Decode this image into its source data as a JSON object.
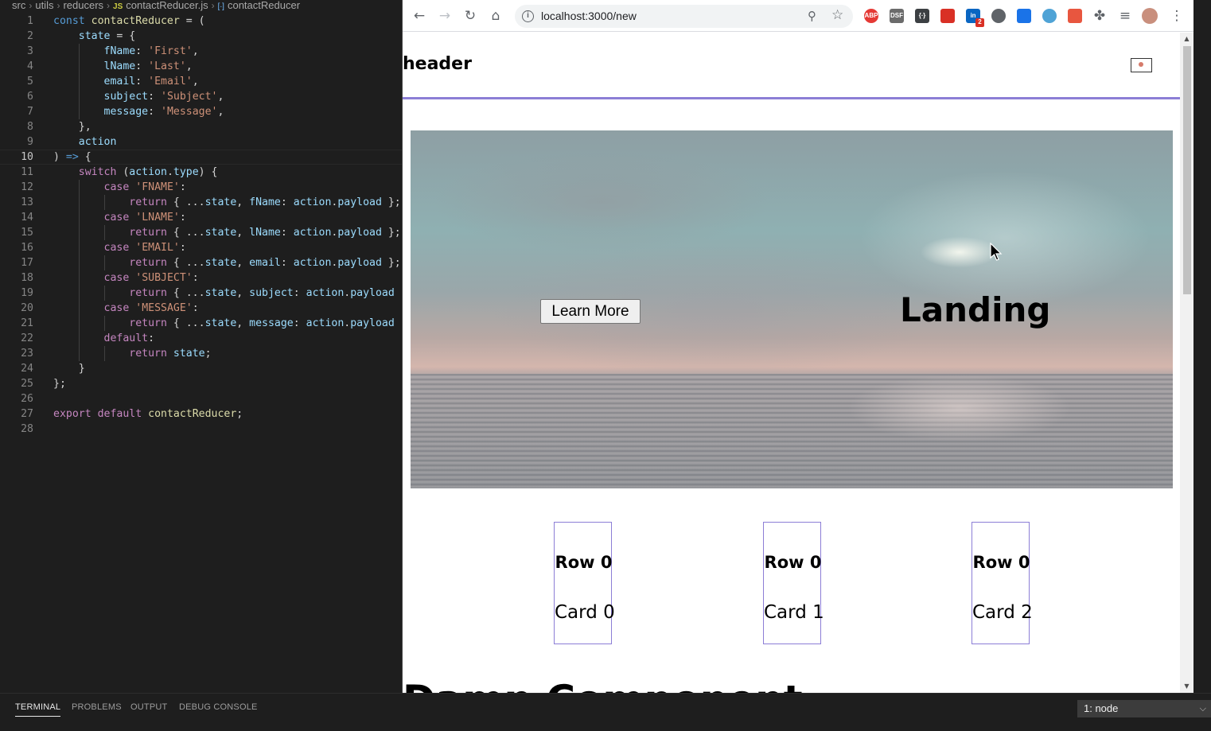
{
  "editor": {
    "breadcrumb": {
      "segments": [
        "src",
        "utils",
        "reducers"
      ],
      "file_badge": "JS",
      "file": "contactReducer.js",
      "symbol_badge": "[∙]",
      "symbol": "contactReducer"
    },
    "current_line": 10,
    "lines": [
      {
        "n": "1"
      },
      {
        "n": "2"
      },
      {
        "n": "3"
      },
      {
        "n": "4"
      },
      {
        "n": "5"
      },
      {
        "n": "6"
      },
      {
        "n": "7"
      },
      {
        "n": "8"
      },
      {
        "n": "9"
      },
      {
        "n": "10"
      },
      {
        "n": "11"
      },
      {
        "n": "12"
      },
      {
        "n": "13"
      },
      {
        "n": "14"
      },
      {
        "n": "15"
      },
      {
        "n": "16"
      },
      {
        "n": "17"
      },
      {
        "n": "18"
      },
      {
        "n": "19"
      },
      {
        "n": "20"
      },
      {
        "n": "21"
      },
      {
        "n": "22"
      },
      {
        "n": "23"
      },
      {
        "n": "24"
      },
      {
        "n": "25"
      },
      {
        "n": "26"
      },
      {
        "n": "27"
      },
      {
        "n": "28"
      }
    ],
    "tokens": {
      "t1a": "const",
      "t1b": "contactReducer",
      "t1c": " = (",
      "t2a": "state",
      "t2b": " = {",
      "t3a": "fName",
      "t3b": ": ",
      "t3c": "'First'",
      "t3d": ",",
      "t4a": "lName",
      "t4b": ": ",
      "t4c": "'Last'",
      "t4d": ",",
      "t5a": "email",
      "t5b": ": ",
      "t5c": "'Email'",
      "t5d": ",",
      "t6a": "subject",
      "t6b": ": ",
      "t6c": "'Subject'",
      "t6d": ",",
      "t7a": "message",
      "t7b": ": ",
      "t7c": "'Message'",
      "t7d": ",",
      "t8a": "},",
      "t9a": "action",
      "t10a": ") ",
      "t10b": "=>",
      "t10c": " {",
      "t11a": "switch",
      "t11b": " (",
      "t11c": "action",
      "t11d": ".",
      "t11e": "type",
      "t11f": ") {",
      "t12a": "case",
      "t12b": " ",
      "t12c": "'FNAME'",
      "t12d": ":",
      "t13a": "return",
      "t13b": " { ...",
      "t13c": "state",
      "t13d": ", ",
      "t13e": "fName",
      "t13f": ": ",
      "t13g": "action",
      "t13h": ".",
      "t13i": "payload",
      "t13j": " };",
      "t14a": "case",
      "t14b": " ",
      "t14c": "'LNAME'",
      "t14d": ":",
      "t15a": "return",
      "t15b": " { ...",
      "t15c": "state",
      "t15d": ", ",
      "t15e": "lName",
      "t15f": ": ",
      "t15g": "action",
      "t15h": ".",
      "t15i": "payload",
      "t15j": " };",
      "t16a": "case",
      "t16b": " ",
      "t16c": "'EMAIL'",
      "t16d": ":",
      "t17a": "return",
      "t17b": " { ...",
      "t17c": "state",
      "t17d": ", ",
      "t17e": "email",
      "t17f": ": ",
      "t17g": "action",
      "t17h": ".",
      "t17i": "payload",
      "t17j": " };",
      "t18a": "case",
      "t18b": " ",
      "t18c": "'SUBJECT'",
      "t18d": ":",
      "t19a": "return",
      "t19b": " { ...",
      "t19c": "state",
      "t19d": ", ",
      "t19e": "subject",
      "t19f": ": ",
      "t19g": "action",
      "t19h": ".",
      "t19i": "payload",
      "t19j": " };",
      "t20a": "case",
      "t20b": " ",
      "t20c": "'MESSAGE'",
      "t20d": ":",
      "t21a": "return",
      "t21b": " { ...",
      "t21c": "state",
      "t21d": ", ",
      "t21e": "message",
      "t21f": ": ",
      "t21g": "action",
      "t21h": ".",
      "t21i": "payload",
      "t21j": " };",
      "t22a": "default",
      "t22b": ":",
      "t23a": "return",
      "t23b": " ",
      "t23c": "state",
      "t23d": ";",
      "t24a": "}",
      "t25a": "};",
      "t27a": "export",
      "t27b": " ",
      "t27c": "default",
      "t27d": " ",
      "t27e": "contactReducer",
      "t27f": ";"
    }
  },
  "panel": {
    "tabs": [
      "TERMINAL",
      "PROBLEMS",
      "OUTPUT",
      "DEBUG CONSOLE"
    ],
    "active_tab": "TERMINAL",
    "terminal_select": "1: node"
  },
  "browser": {
    "url": "localhost:3000/new",
    "extensions": [
      {
        "name": "adblock-plus-icon",
        "label": "ABP",
        "color": "#e53935"
      },
      {
        "name": "extension-dsf-icon",
        "label": "DSF",
        "color": "#6b6b6b"
      },
      {
        "name": "json-viewer-icon",
        "label": "{∙}",
        "color": "#3c4043"
      },
      {
        "name": "extension-red-icon",
        "label": "",
        "color": "#d93025"
      },
      {
        "name": "linkedin-icon",
        "label": "in",
        "color": "#0a66c2",
        "badge": "2"
      },
      {
        "name": "dark-mode-icon",
        "label": "",
        "color": "#5f6368"
      },
      {
        "name": "extension-arc-icon",
        "label": "",
        "color": "#1a73e8"
      },
      {
        "name": "extension-circle-icon",
        "label": "",
        "color": "#4fa3d6"
      },
      {
        "name": "extension-lock-icon",
        "label": "",
        "color": "#e8563f"
      }
    ],
    "page": {
      "header_title": "header",
      "hero_button": "Learn More",
      "hero_title": "Landing",
      "cards": [
        {
          "row": "Row 0",
          "name": "Card 0"
        },
        {
          "row": "Row 0",
          "name": "Card 1"
        },
        {
          "row": "Row 0",
          "name": "Card 2"
        }
      ],
      "cut_heading": "Damn Component"
    }
  },
  "colors": {
    "editor_bg": "#1e1e1e",
    "keyword": "#569cd6",
    "control": "#c586c0",
    "function": "#dcdcaa",
    "variable": "#9cdcfe",
    "string": "#ce9178",
    "header_border": "#8c7ed6"
  }
}
